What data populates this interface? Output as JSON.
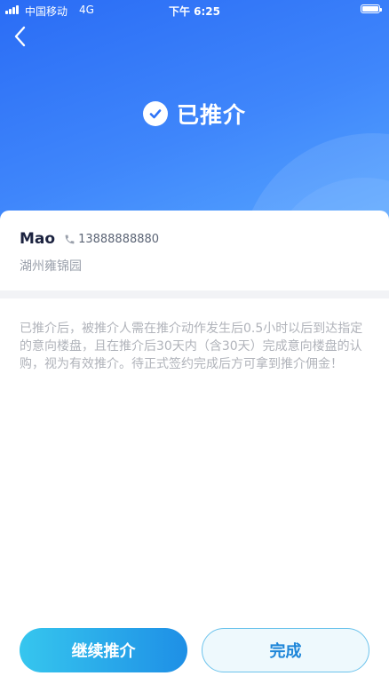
{
  "status_bar": {
    "carrier": "中国移动",
    "network": "4G",
    "time": "下午 6:25"
  },
  "header": {
    "title": "已推介"
  },
  "client": {
    "name": "Mao",
    "phone": "13888888880",
    "project": "湖州雍锦园"
  },
  "notice": "已推介后，被推介人需在推介动作发生后0.5小时以后到达指定的意向楼盘，且在推介后30天内（含30天）完成意向楼盘的认购，视为有效推介。待正式签约完成后方可拿到推介佣金！",
  "buttons": {
    "continue_label": "继续推介",
    "done_label": "完成"
  },
  "colors": {
    "header_gradient_start": "#2a6cf5",
    "header_gradient_end": "#56a6ff",
    "primary_button_start": "#36c6ee",
    "primary_button_end": "#1e8fe6",
    "secondary_button_text": "#1e86d9"
  }
}
